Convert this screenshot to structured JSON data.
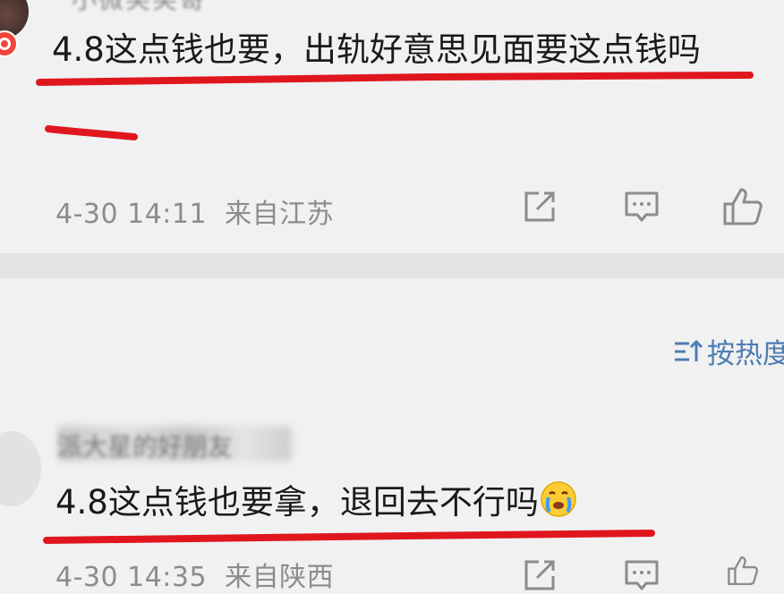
{
  "comments": [
    {
      "username": "小微笑笑哥",
      "text": "4.8这点钱也要，出轨好意思见面要这点钱吗",
      "time": "4-30 14:11",
      "location": "来自江苏",
      "badge_color": "#f0463c"
    },
    {
      "username": "派大星的好朋友",
      "text": "4.8这点钱也要拿，退回去不行吗",
      "time": "4-30 14:35",
      "location": "来自陕西",
      "emoji": "crying-face-emoji"
    }
  ],
  "sort": {
    "label": "按热度",
    "icon": "sort-icon"
  },
  "actions": {
    "share_icon": "share-icon",
    "comment_icon": "comment-icon",
    "like_icon": "like-icon"
  },
  "colors": {
    "background": "#f1f1f1",
    "divider": "#e3e3e3",
    "link": "#4d7db3",
    "underline": "#e0161f",
    "meta": "#8c8c8c"
  }
}
